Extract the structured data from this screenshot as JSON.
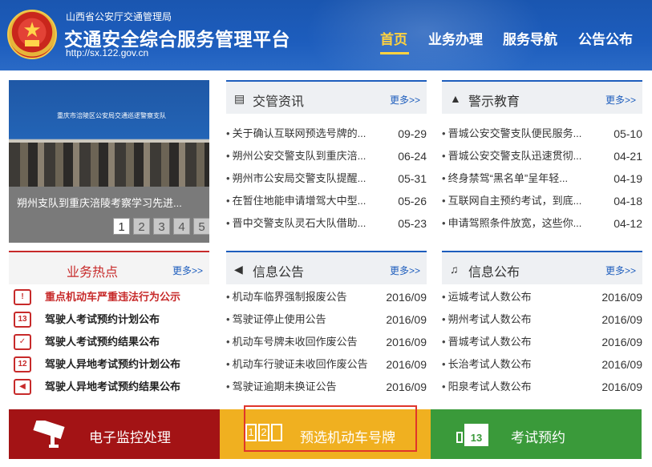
{
  "header": {
    "subtitle": "山西省公安厅交通管理局",
    "title": "交通安全综合服务管理平台",
    "url": "http://sx.122.gov.cn",
    "emblem_star": "★",
    "nav": [
      "首页",
      "业务办理",
      "服务导航",
      "公告公布"
    ]
  },
  "slider": {
    "photo_banner": "重庆市涪陵区公安局交通巡逻警察支队",
    "caption": "朔州支队到重庆涪陵考察学习先进...",
    "pages": [
      "1",
      "2",
      "3",
      "4",
      "5"
    ],
    "active_page": "1"
  },
  "panels": {
    "jiaoguan": {
      "title": "交管资讯",
      "icon": "newspaper-icon",
      "icon_glyph": "▤",
      "more": "更多>>",
      "items": [
        {
          "title": "关于确认互联网预选号牌的...",
          "date": "09-29"
        },
        {
          "title": "朔州公安交警支队到重庆涪...",
          "date": "06-24"
        },
        {
          "title": "朔州市公安局交警支队提醒...",
          "date": "05-31"
        },
        {
          "title": "在暂住地能申请增驾大中型...",
          "date": "05-26"
        },
        {
          "title": "晋中交警支队灵石大队借助...",
          "date": "05-23"
        }
      ]
    },
    "jingshi": {
      "title": "警示教育",
      "icon": "warning-icon",
      "icon_glyph": "▲",
      "more": "更多>>",
      "items": [
        {
          "title": "晋城公安交警支队便民服务...",
          "date": "05-10"
        },
        {
          "title": "晋城公安交警支队迅速贯彻...",
          "date": "04-21"
        },
        {
          "title": "终身禁驾“黑名单”呈年轻...",
          "date": "04-19"
        },
        {
          "title": "互联网自主预约考试，到底...",
          "date": "04-18"
        },
        {
          "title": "申请驾照条件放宽，这些你...",
          "date": "04-12"
        }
      ]
    },
    "xinxi_gonggao": {
      "title": "信息公告",
      "icon": "megaphone-icon",
      "icon_glyph": "◀",
      "more": "更多>>",
      "items": [
        {
          "title": "机动车临界强制报废公告",
          "date": "2016/09"
        },
        {
          "title": "驾驶证停止使用公告",
          "date": "2016/09"
        },
        {
          "title": "机动车号牌未收回作废公告",
          "date": "2016/09"
        },
        {
          "title": "机动车行驶证未收回作废公告",
          "date": "2016/09"
        },
        {
          "title": "驾驶证逾期未换证公告",
          "date": "2016/09"
        }
      ]
    },
    "xinxi_gongbu": {
      "title": "信息公布",
      "icon": "bell-icon",
      "icon_glyph": "♫",
      "more": "更多>>",
      "items": [
        {
          "title": "运城考试人数公布",
          "date": "2016/09"
        },
        {
          "title": "朔州考试人数公布",
          "date": "2016/09"
        },
        {
          "title": "晋城考试人数公布",
          "date": "2016/09"
        },
        {
          "title": "长治考试人数公布",
          "date": "2016/09"
        },
        {
          "title": "阳泉考试人数公布",
          "date": "2016/09"
        }
      ]
    }
  },
  "hot": {
    "title": "业务热点",
    "more": "更多>>",
    "items": [
      {
        "label": "重点机动车严重违法行为公示",
        "icon": "warning-car-icon",
        "glyph": "!"
      },
      {
        "label": "驾驶人考试预约计划公布",
        "icon": "calendar-icon",
        "glyph": "13"
      },
      {
        "label": "驾驶人考试预约结果公布",
        "icon": "calendar-check-icon",
        "glyph": "✓"
      },
      {
        "label": "驾驶人异地考试预约计划公布",
        "icon": "plate-icon",
        "glyph": "12"
      },
      {
        "label": "驾驶人异地考试预约结果公布",
        "icon": "megaphone-icon",
        "glyph": "◀"
      }
    ]
  },
  "bottom": {
    "monitor": "电子监控处理",
    "plate": "预选机动车号牌",
    "exam": "考试预约",
    "plate_digits": [
      "1",
      "2"
    ],
    "calendar_day": "13"
  },
  "colors": {
    "brand_blue": "#1d5dbd",
    "nav_active": "#ffd23f",
    "hot_red": "#c72a2a",
    "btn_red": "#a31315",
    "btn_yellow": "#f0b020",
    "btn_green": "#3a9a3a",
    "highlight": "#e0352b"
  }
}
